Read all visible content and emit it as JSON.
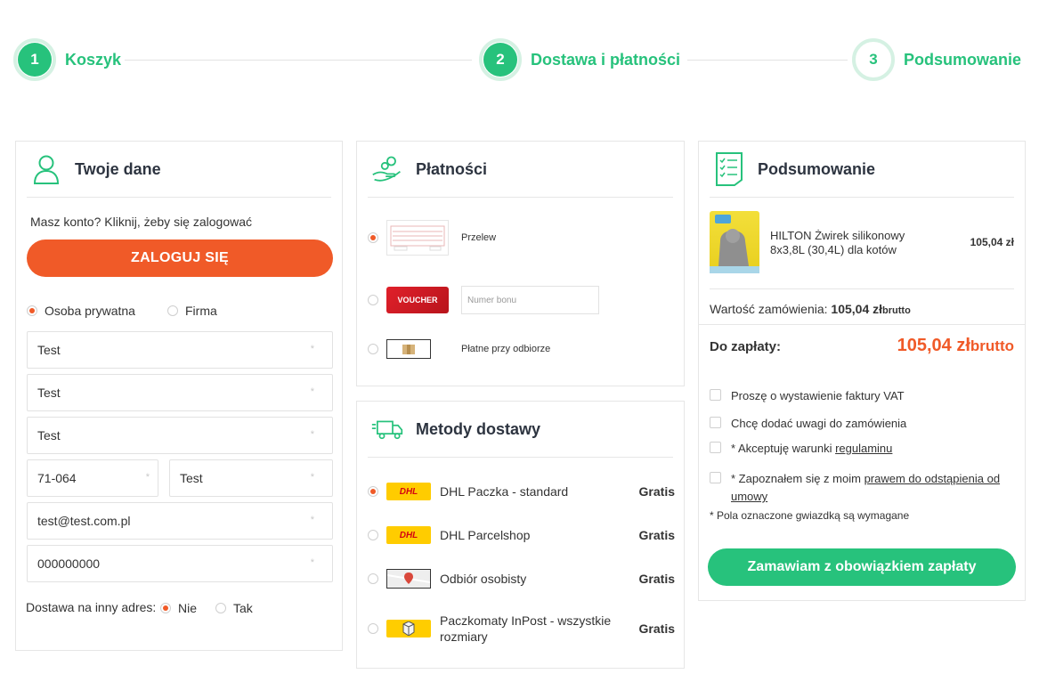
{
  "steps": [
    {
      "number": "1",
      "label": "Koszyk"
    },
    {
      "number": "2",
      "label": "Dostawa i płatności"
    },
    {
      "number": "3",
      "label": "Podsumowanie"
    }
  ],
  "accent_color": "#27c27c",
  "cta_color": "#f05a28",
  "customer": {
    "title": "Twoje dane",
    "login_prompt": "Masz konto? Kliknij, żeby się zalogować",
    "login_button": "ZALOGUJ SIĘ",
    "type_options": [
      {
        "label": "Osoba prywatna",
        "selected": true
      },
      {
        "label": "Firma",
        "selected": false
      }
    ],
    "fields": {
      "first_name": "Test",
      "last_name": "Test",
      "street": "Test",
      "postal_code": "71-064",
      "city": "Test",
      "email": "test@test.com.pl",
      "phone": "000000000"
    },
    "required_mark": "*",
    "other_address_label": "Dostawa na inny adres:",
    "other_address_options": [
      {
        "label": "Nie",
        "selected": true
      },
      {
        "label": "Tak",
        "selected": false
      }
    ]
  },
  "payments": {
    "title": "Płatności",
    "options": [
      {
        "label": "Przelew",
        "selected": true,
        "icon": "bank-transfer-icon"
      },
      {
        "label": "VOUCHER",
        "selected": false,
        "icon": "voucher-icon",
        "placeholder": "Numer bonu"
      },
      {
        "label": "Płatne przy odbiorze",
        "selected": false,
        "icon": "package-icon"
      }
    ]
  },
  "delivery": {
    "title": "Metody dostawy",
    "options": [
      {
        "label": "DHL Paczka - standard",
        "price": "Gratis",
        "selected": true,
        "logo": "DHL"
      },
      {
        "label": "DHL Parcelshop",
        "price": "Gratis",
        "selected": false,
        "logo": "DHL"
      },
      {
        "label": "Odbiór osobisty",
        "price": "Gratis",
        "selected": false,
        "logo": "map-pin-icon"
      },
      {
        "label": "Paczkomaty InPost - wszystkie rozmiary",
        "price": "Gratis",
        "selected": false,
        "logo": "inpost-icon"
      }
    ]
  },
  "summary": {
    "title": "Podsumowanie",
    "product": {
      "name": "HILTON Żwirek silikonowy 8x3,8L (30,4L) dla kotów",
      "price": "105,04 zł"
    },
    "order_value_label": "Wartość zamówienia:",
    "order_value": "105,04 zł",
    "brutto": "brutto",
    "to_pay_label": "Do zapłaty:",
    "to_pay": "105,04 zł",
    "checks": [
      {
        "text": "Proszę o wystawienie faktury VAT"
      },
      {
        "text": "Chcę dodać uwagi do zamówienia"
      },
      {
        "prefix": "* Akceptuję warunki ",
        "link": "regulaminu"
      },
      {
        "prefix": "* Zapoznałem się z moim ",
        "link": "prawem do odstąpienia od umowy"
      }
    ],
    "required_note": "* Pola oznaczone gwiazdką są wymagane",
    "order_button": "Zamawiam z obowiązkiem zapłaty"
  }
}
